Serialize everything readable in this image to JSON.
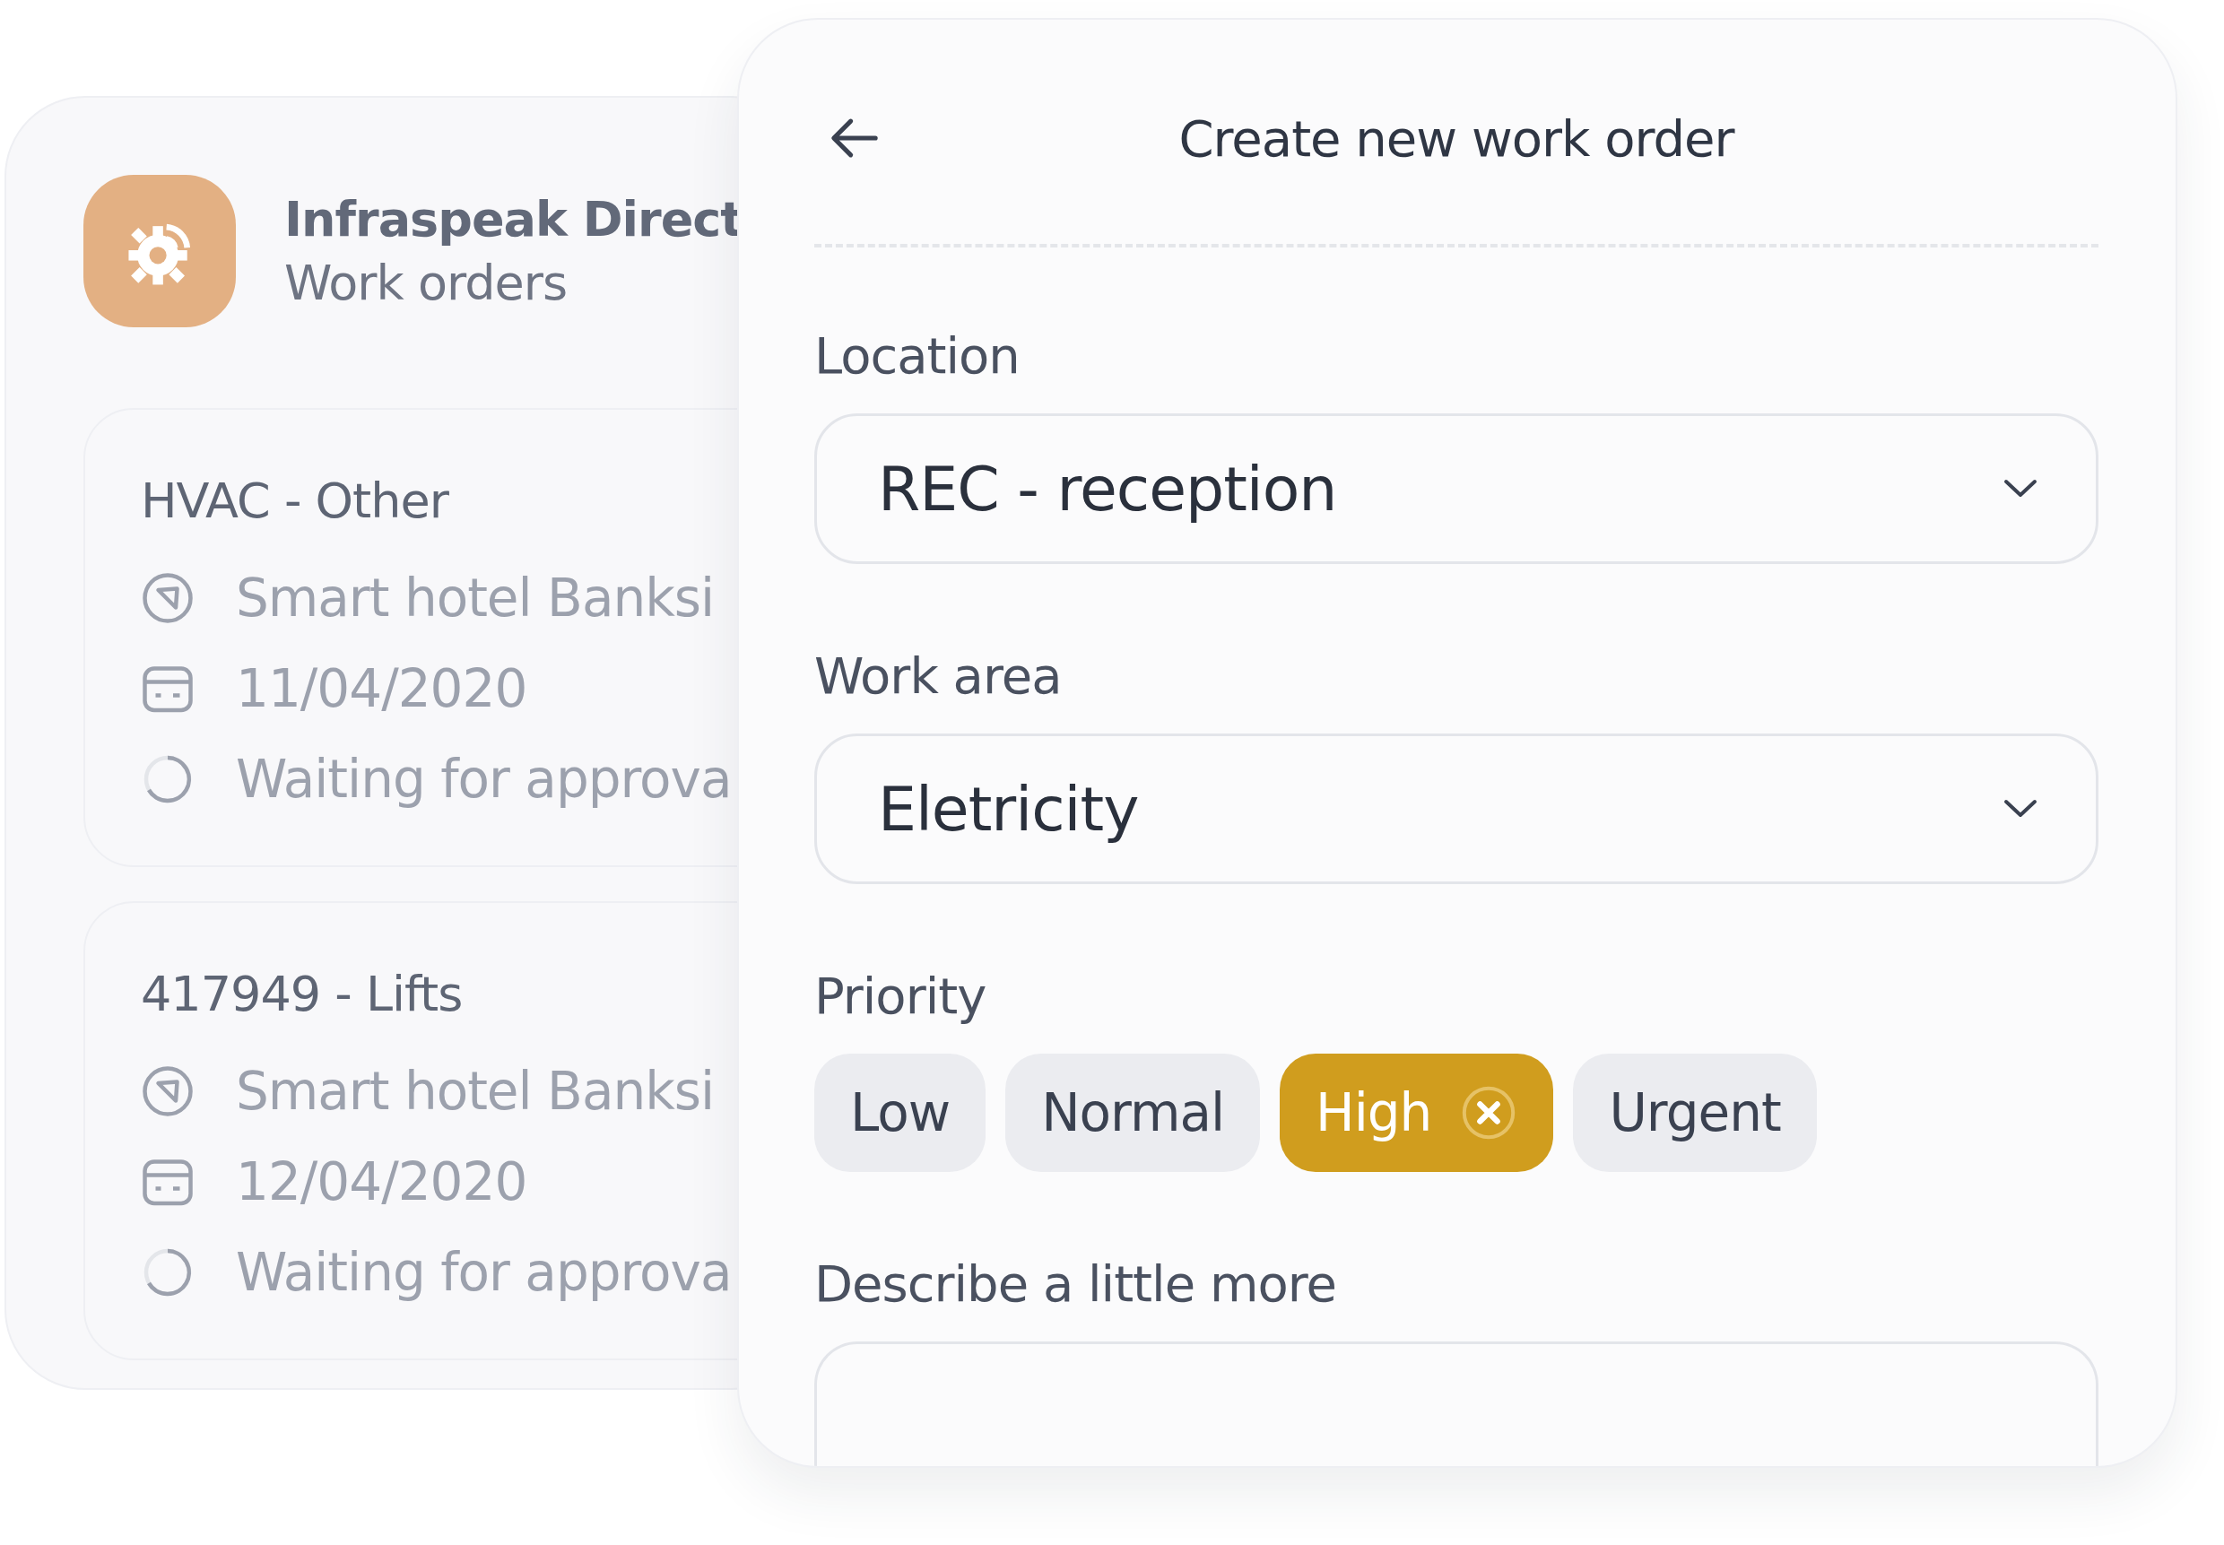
{
  "app_panel": {
    "app_name": "Infraspeak Direct",
    "section": "Work orders",
    "work_orders": [
      {
        "title": "HVAC - Other",
        "location": "Smart hotel Banksi",
        "date": "11/04/2020",
        "status": "Waiting for approva"
      },
      {
        "title": "417949 - Lifts",
        "location": "Smart hotel Banksi",
        "date": "12/04/2020",
        "status": "Waiting for approva"
      }
    ]
  },
  "form": {
    "title": "Create new work order",
    "fields": [
      {
        "kind": "select",
        "label": "Location",
        "value": "REC - reception"
      },
      {
        "kind": "select",
        "label": "Work area",
        "value": "Eletricity"
      },
      {
        "kind": "chips",
        "label": "Priority",
        "options": [
          {
            "label": "Low",
            "selected": false
          },
          {
            "label": "Normal",
            "selected": false
          },
          {
            "label": "High",
            "selected": true
          },
          {
            "label": "Urgent",
            "selected": false
          }
        ]
      },
      {
        "kind": "textarea",
        "label": "Describe a little more"
      }
    ]
  }
}
